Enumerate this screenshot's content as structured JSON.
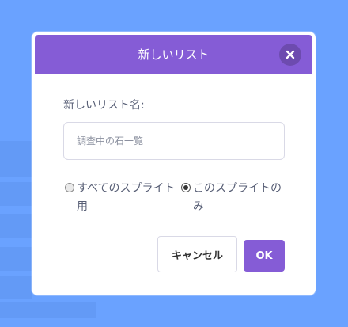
{
  "modal": {
    "title": "新しいリスト",
    "field_label": "新しいリスト名:",
    "input_value": "",
    "input_placeholder": "調査中の石一覧",
    "radio_options": [
      {
        "label": "すべてのスプライト用",
        "checked": false
      },
      {
        "label": "このスプライトのみ",
        "checked": true
      }
    ],
    "cancel_label": "キャンセル",
    "ok_label": "OK"
  },
  "colors": {
    "backdrop": "#6aa2ff",
    "accent": "#855cd6",
    "text": "#575e75"
  },
  "icons": {
    "close": "close-icon"
  }
}
